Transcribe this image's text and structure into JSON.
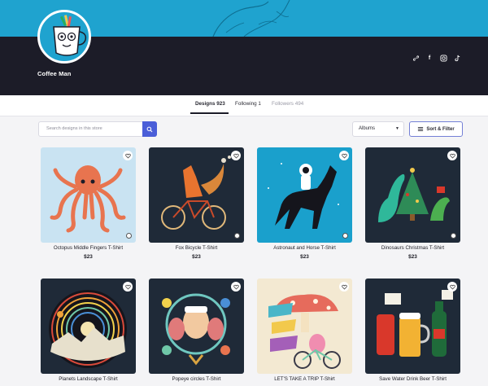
{
  "store": {
    "name": "Coffee Man"
  },
  "social": [
    "link-icon",
    "facebook-icon",
    "instagram-icon",
    "tiktok-icon"
  ],
  "tabs": {
    "designs": "Designs 923",
    "following": "Following 1",
    "followers": "Followers 494"
  },
  "toolbar": {
    "search_placeholder": "Search designs in this store",
    "albums": "Albums",
    "sort_filter": "Sort & Filter"
  },
  "colors": {
    "accent": "#4a5ed8",
    "banner": "#1fa3cf",
    "profile_bar": "#1c1c28"
  },
  "products": [
    {
      "title": "Octopus Middle Fingers T-Shirt",
      "price": "$23",
      "bg": "#c9e3f2"
    },
    {
      "title": "Fox Bicycle T-Shirt",
      "price": "$23",
      "bg": "#1f2a38"
    },
    {
      "title": "Astronaut and Horse T-Shirt",
      "price": "$23",
      "bg": "#1aa0cc"
    },
    {
      "title": "Dinosaurs Christmas T-Shirt",
      "price": "$23",
      "bg": "#1f2a38"
    },
    {
      "title": "Planets Landscape T-Shirt",
      "price": "",
      "bg": "#1f2a38"
    },
    {
      "title": "Popeye circles T-Shirt",
      "price": "",
      "bg": "#1f2a38"
    },
    {
      "title": "LET'S TAKE A TRIP T-Shirt",
      "price": "",
      "bg": "#f3e9d2"
    },
    {
      "title": "Save Water Drink Beer T-Shirt",
      "price": "",
      "bg": "#1f2a38"
    }
  ]
}
